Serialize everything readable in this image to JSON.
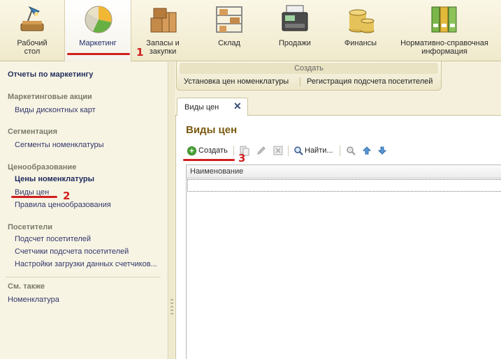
{
  "sections": [
    {
      "id": "desktop",
      "label": "Рабочий\nстол",
      "icon": "desktop-icon"
    },
    {
      "id": "marketing",
      "label": "Маркетинг",
      "icon": "pie-chart-icon",
      "active": true
    },
    {
      "id": "stock",
      "label": "Запасы и\nзакупки",
      "icon": "boxes-icon"
    },
    {
      "id": "warehouse",
      "label": "Склад",
      "icon": "shelves-icon"
    },
    {
      "id": "sales",
      "label": "Продажи",
      "icon": "cash-register-icon"
    },
    {
      "id": "finance",
      "label": "Финансы",
      "icon": "coins-icon"
    },
    {
      "id": "reference",
      "label": "Нормативно-справочная\nинформация",
      "icon": "binders-icon"
    }
  ],
  "annotations": {
    "step1": "1",
    "step2": "2",
    "step3": "3",
    "color": "#d01f1f"
  },
  "leftnav": {
    "reports_link": "Отчеты по маркетингу",
    "groups": {
      "campaigns": {
        "title": "Маркетинговые акции",
        "items": [
          "Виды дисконтных карт"
        ]
      },
      "segmentation": {
        "title": "Сегментация",
        "items": [
          "Сегменты номенклатуры"
        ]
      },
      "pricing": {
        "title": "Ценообразование",
        "items": [
          "Цены номенклатуры",
          "Виды цен",
          "Правила ценообразования"
        ]
      },
      "visitors": {
        "title": "Посетители",
        "items": [
          "Подсчет посетителей",
          "Счетчики подсчета посетителей",
          "Настройки загрузки данных счетчиков..."
        ]
      },
      "see_also": {
        "title": "См. также",
        "items": [
          "Номенклатура"
        ]
      }
    }
  },
  "create_panel": {
    "title": "Создать",
    "links": [
      "Установка цен номенклатуры",
      "Регистрация подсчета посетителей"
    ]
  },
  "tab": {
    "label": "Виды цен",
    "close": "✕"
  },
  "form": {
    "title": "Виды цен",
    "toolbar": {
      "create_label": "Создать",
      "find_label": "Найти..."
    },
    "grid": {
      "columns": [
        "Наименование"
      ],
      "rows": []
    }
  },
  "colors": {
    "accent_title": "#7a5a10",
    "nav_text": "#33366a",
    "panel_bg": "#f4f0dc"
  }
}
